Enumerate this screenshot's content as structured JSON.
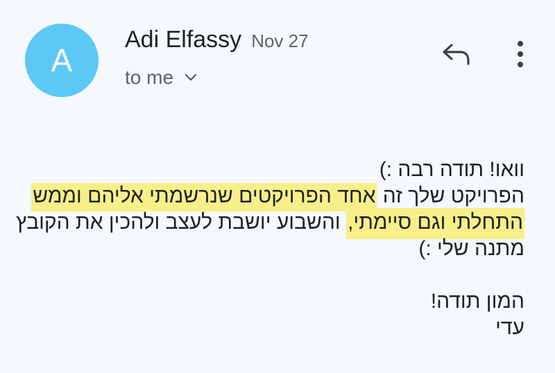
{
  "sender": {
    "avatar_letter": "A",
    "name": "Adi Elfassy",
    "date": "Nov 27",
    "recipient_label": "to me"
  },
  "icons": {
    "recipient_toggle": "chevron-down-icon",
    "reply": "reply-icon",
    "more": "more-vert-icon"
  },
  "colors": {
    "avatar_bg": "#5bc8f5",
    "highlight": "#f7ef8a",
    "background": "#f5f8fc"
  },
  "body": {
    "line1": "וואו! תודה רבה :)",
    "line2_before": "הפרויקט שלך זה ",
    "line2_highlight": "אחד הפרויקטים שנרשמתי אליהם וממש",
    "line3_highlight": "התחלתי וגם סיימתי,",
    "line3_after": " והשבוע יושבת לעצב ולהכין את הקובץ",
    "line4": "מתנה שלי :)",
    "line5": "המון תודה!",
    "signature": "עדי"
  }
}
